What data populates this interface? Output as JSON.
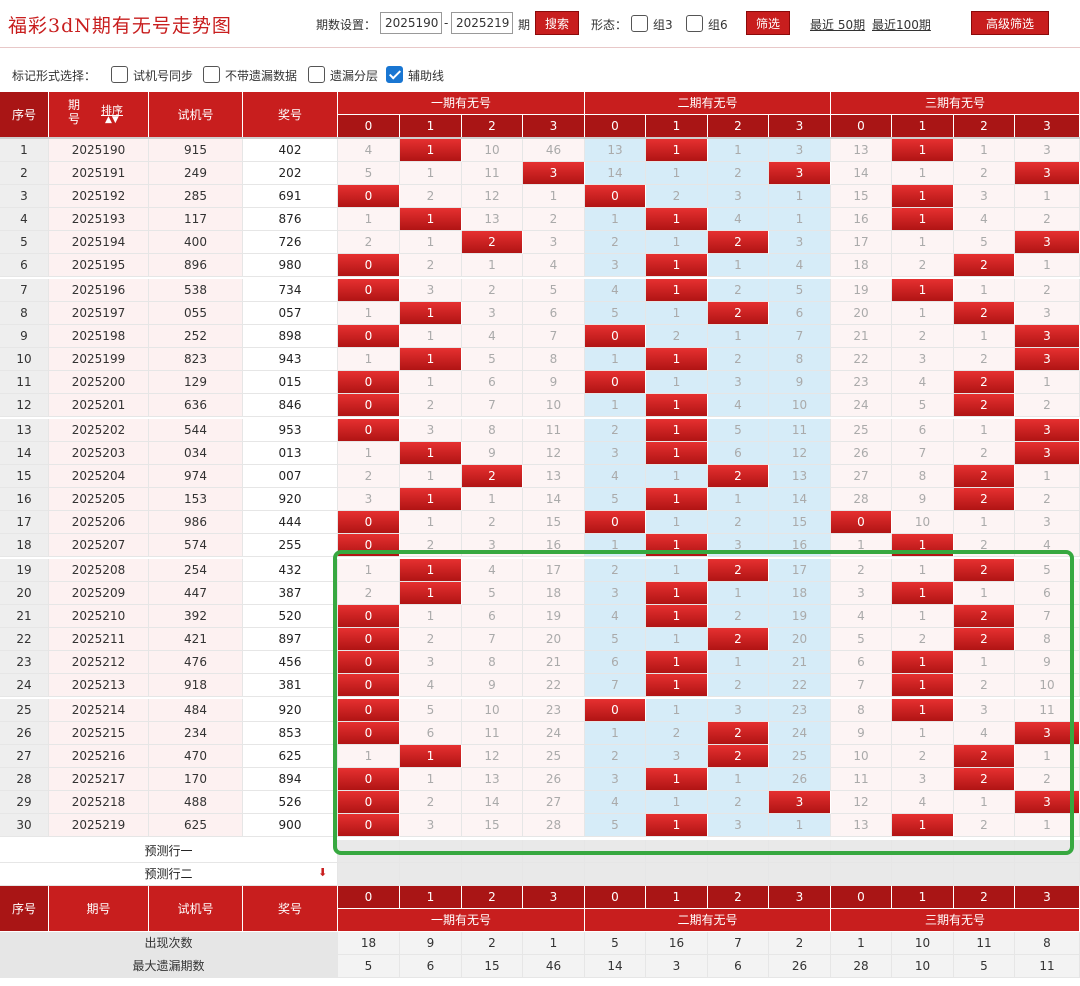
{
  "title": "福彩3dN期有无号走势图",
  "toolbar": {
    "period_label": "期数设置：",
    "from": "2025190",
    "dash": "-",
    "to": "2025219",
    "period_suffix": "期",
    "search": "搜索",
    "form_label": "形态：",
    "group3": "组3",
    "group6": "组6",
    "filter": "筛选",
    "recent50": "最近 50期",
    "recent100": "最近100期",
    "advanced": "高级筛选"
  },
  "markbar": {
    "label": "标记形式选择：",
    "opt1": "试机号同步",
    "opt2": "不带遗漏数据",
    "opt3": "遗漏分层",
    "opt4": "辅助线"
  },
  "headers": {
    "seq": "序号",
    "period": "期号",
    "sort": "排序",
    "trial": "试机号",
    "award": "奖号",
    "g1": "一期有无号",
    "g2": "二期有无号",
    "g3": "三期有无号",
    "digits": [
      "0",
      "1",
      "2",
      "3"
    ]
  },
  "rows": [
    {
      "seq": "1",
      "period": "2025190",
      "trial": "915",
      "award": "402",
      "cells": [
        "4",
        "1",
        "10",
        "46",
        "13",
        "1",
        "1",
        "3",
        "13",
        "1",
        "1",
        "3"
      ],
      "hits": [
        1,
        5,
        9
      ]
    },
    {
      "seq": "2",
      "period": "2025191",
      "trial": "249",
      "award": "202",
      "cells": [
        "5",
        "1",
        "11",
        "3",
        "14",
        "1",
        "2",
        "3",
        "14",
        "1",
        "2",
        "3"
      ],
      "hits": [
        3,
        7,
        11
      ]
    },
    {
      "seq": "3",
      "period": "2025192",
      "trial": "285",
      "award": "691",
      "cells": [
        "0",
        "2",
        "12",
        "1",
        "0",
        "2",
        "3",
        "1",
        "15",
        "1",
        "3",
        "1"
      ],
      "hits": [
        0,
        4,
        9
      ]
    },
    {
      "seq": "4",
      "period": "2025193",
      "trial": "117",
      "award": "876",
      "cells": [
        "1",
        "1",
        "13",
        "2",
        "1",
        "1",
        "4",
        "1",
        "16",
        "1",
        "4",
        "2"
      ],
      "hits": [
        1,
        5,
        9
      ]
    },
    {
      "seq": "5",
      "period": "2025194",
      "trial": "400",
      "award": "726",
      "cells": [
        "2",
        "1",
        "2",
        "3",
        "2",
        "1",
        "2",
        "3",
        "17",
        "1",
        "5",
        "3"
      ],
      "hits": [
        2,
        6,
        11
      ]
    },
    {
      "seq": "6",
      "period": "2025195",
      "trial": "896",
      "award": "980",
      "cells": [
        "0",
        "2",
        "1",
        "4",
        "3",
        "1",
        "1",
        "4",
        "18",
        "2",
        "2",
        "1"
      ],
      "hits": [
        0,
        5,
        10
      ]
    },
    {
      "seq": "7",
      "period": "2025196",
      "trial": "538",
      "award": "734",
      "cells": [
        "0",
        "3",
        "2",
        "5",
        "4",
        "1",
        "2",
        "5",
        "19",
        "1",
        "1",
        "2"
      ],
      "hits": [
        0,
        5,
        9
      ]
    },
    {
      "seq": "8",
      "period": "2025197",
      "trial": "055",
      "award": "057",
      "cells": [
        "1",
        "1",
        "3",
        "6",
        "5",
        "1",
        "2",
        "6",
        "20",
        "1",
        "2",
        "3"
      ],
      "hits": [
        1,
        6,
        10
      ]
    },
    {
      "seq": "9",
      "period": "2025198",
      "trial": "252",
      "award": "898",
      "cells": [
        "0",
        "1",
        "4",
        "7",
        "0",
        "2",
        "1",
        "7",
        "21",
        "2",
        "1",
        "3"
      ],
      "hits": [
        0,
        4,
        11
      ]
    },
    {
      "seq": "10",
      "period": "2025199",
      "trial": "823",
      "award": "943",
      "cells": [
        "1",
        "1",
        "5",
        "8",
        "1",
        "1",
        "2",
        "8",
        "22",
        "3",
        "2",
        "3"
      ],
      "hits": [
        1,
        5,
        11
      ]
    },
    {
      "seq": "11",
      "period": "2025200",
      "trial": "129",
      "award": "015",
      "cells": [
        "0",
        "1",
        "6",
        "9",
        "0",
        "1",
        "3",
        "9",
        "23",
        "4",
        "2",
        "1"
      ],
      "hits": [
        0,
        4,
        10
      ]
    },
    {
      "seq": "12",
      "period": "2025201",
      "trial": "636",
      "award": "846",
      "cells": [
        "0",
        "2",
        "7",
        "10",
        "1",
        "1",
        "4",
        "10",
        "24",
        "5",
        "2",
        "2"
      ],
      "hits": [
        0,
        5,
        10
      ]
    },
    {
      "seq": "13",
      "period": "2025202",
      "trial": "544",
      "award": "953",
      "cells": [
        "0",
        "3",
        "8",
        "11",
        "2",
        "1",
        "5",
        "11",
        "25",
        "6",
        "1",
        "3"
      ],
      "hits": [
        0,
        5,
        11
      ]
    },
    {
      "seq": "14",
      "period": "2025203",
      "trial": "034",
      "award": "013",
      "cells": [
        "1",
        "1",
        "9",
        "12",
        "3",
        "1",
        "6",
        "12",
        "26",
        "7",
        "2",
        "3"
      ],
      "hits": [
        1,
        5,
        11
      ]
    },
    {
      "seq": "15",
      "period": "2025204",
      "trial": "974",
      "award": "007",
      "cells": [
        "2",
        "1",
        "2",
        "13",
        "4",
        "1",
        "2",
        "13",
        "27",
        "8",
        "2",
        "1"
      ],
      "hits": [
        2,
        6,
        10
      ]
    },
    {
      "seq": "16",
      "period": "2025205",
      "trial": "153",
      "award": "920",
      "cells": [
        "3",
        "1",
        "1",
        "14",
        "5",
        "1",
        "1",
        "14",
        "28",
        "9",
        "2",
        "2"
      ],
      "hits": [
        1,
        5,
        10
      ]
    },
    {
      "seq": "17",
      "period": "2025206",
      "trial": "986",
      "award": "444",
      "cells": [
        "0",
        "1",
        "2",
        "15",
        "0",
        "1",
        "2",
        "15",
        "0",
        "10",
        "1",
        "3"
      ],
      "hits": [
        0,
        4,
        8
      ]
    },
    {
      "seq": "18",
      "period": "2025207",
      "trial": "574",
      "award": "255",
      "cells": [
        "0",
        "2",
        "3",
        "16",
        "1",
        "1",
        "3",
        "16",
        "1",
        "1",
        "2",
        "4"
      ],
      "hits": [
        0,
        5,
        9
      ]
    },
    {
      "seq": "19",
      "period": "2025208",
      "trial": "254",
      "award": "432",
      "cells": [
        "1",
        "1",
        "4",
        "17",
        "2",
        "1",
        "2",
        "17",
        "2",
        "1",
        "2",
        "5"
      ],
      "hits": [
        1,
        6,
        10
      ]
    },
    {
      "seq": "20",
      "period": "2025209",
      "trial": "447",
      "award": "387",
      "cells": [
        "2",
        "1",
        "5",
        "18",
        "3",
        "1",
        "1",
        "18",
        "3",
        "1",
        "1",
        "6"
      ],
      "hits": [
        1,
        5,
        9
      ]
    },
    {
      "seq": "21",
      "period": "2025210",
      "trial": "392",
      "award": "520",
      "cells": [
        "0",
        "1",
        "6",
        "19",
        "4",
        "1",
        "2",
        "19",
        "4",
        "1",
        "2",
        "7"
      ],
      "hits": [
        0,
        5,
        10
      ]
    },
    {
      "seq": "22",
      "period": "2025211",
      "trial": "421",
      "award": "897",
      "cells": [
        "0",
        "2",
        "7",
        "20",
        "5",
        "1",
        "2",
        "20",
        "5",
        "2",
        "2",
        "8"
      ],
      "hits": [
        0,
        6,
        10
      ]
    },
    {
      "seq": "23",
      "period": "2025212",
      "trial": "476",
      "award": "456",
      "cells": [
        "0",
        "3",
        "8",
        "21",
        "6",
        "1",
        "1",
        "21",
        "6",
        "1",
        "1",
        "9"
      ],
      "hits": [
        0,
        5,
        9
      ]
    },
    {
      "seq": "24",
      "period": "2025213",
      "trial": "918",
      "award": "381",
      "cells": [
        "0",
        "4",
        "9",
        "22",
        "7",
        "1",
        "2",
        "22",
        "7",
        "1",
        "2",
        "10"
      ],
      "hits": [
        0,
        5,
        9
      ]
    },
    {
      "seq": "25",
      "period": "2025214",
      "trial": "484",
      "award": "920",
      "cells": [
        "0",
        "5",
        "10",
        "23",
        "0",
        "1",
        "3",
        "23",
        "8",
        "1",
        "3",
        "11"
      ],
      "hits": [
        0,
        4,
        9
      ]
    },
    {
      "seq": "26",
      "period": "2025215",
      "trial": "234",
      "award": "853",
      "cells": [
        "0",
        "6",
        "11",
        "24",
        "1",
        "2",
        "2",
        "24",
        "9",
        "1",
        "4",
        "3"
      ],
      "hits": [
        0,
        6,
        11
      ]
    },
    {
      "seq": "27",
      "period": "2025216",
      "trial": "470",
      "award": "625",
      "cells": [
        "1",
        "1",
        "12",
        "25",
        "2",
        "3",
        "2",
        "25",
        "10",
        "2",
        "2",
        "1"
      ],
      "hits": [
        1,
        6,
        10
      ]
    },
    {
      "seq": "28",
      "period": "2025217",
      "trial": "170",
      "award": "894",
      "cells": [
        "0",
        "1",
        "13",
        "26",
        "3",
        "1",
        "1",
        "26",
        "11",
        "3",
        "2",
        "2"
      ],
      "hits": [
        0,
        5,
        10
      ]
    },
    {
      "seq": "29",
      "period": "2025218",
      "trial": "488",
      "award": "526",
      "cells": [
        "0",
        "2",
        "14",
        "27",
        "4",
        "1",
        "2",
        "3",
        "12",
        "4",
        "1",
        "3"
      ],
      "hits": [
        0,
        7,
        11
      ]
    },
    {
      "seq": "30",
      "period": "2025219",
      "trial": "625",
      "award": "900",
      "cells": [
        "0",
        "3",
        "15",
        "28",
        "5",
        "1",
        "3",
        "1",
        "13",
        "1",
        "2",
        "1"
      ],
      "hits": [
        0,
        5,
        9
      ]
    }
  ],
  "predict": [
    "预测行一",
    "预测行二"
  ],
  "stats": [
    {
      "label": "出现次数",
      "values": [
        "18",
        "9",
        "2",
        "1",
        "5",
        "16",
        "7",
        "2",
        "1",
        "10",
        "11",
        "8"
      ]
    },
    {
      "label": "最大遗漏期数",
      "values": [
        "5",
        "6",
        "15",
        "46",
        "14",
        "3",
        "6",
        "26",
        "28",
        "10",
        "5",
        "11"
      ]
    }
  ],
  "colors": {
    "brand": "#c81e1e",
    "hit": "#d42020",
    "group2_bg": "#d6ecf8",
    "highlight": "#37a840"
  }
}
